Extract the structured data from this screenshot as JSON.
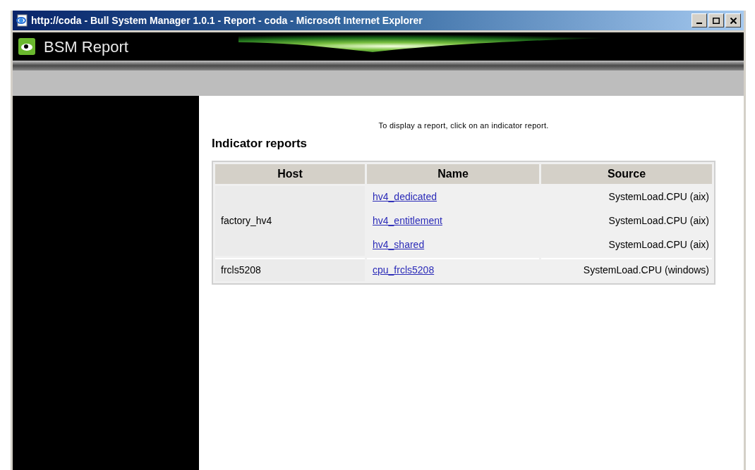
{
  "window": {
    "title": "http://coda - Bull System Manager 1.0.1 - Report - coda - Microsoft Internet Explorer"
  },
  "header": {
    "title": "BSM Report"
  },
  "content": {
    "instruction": "To display a report, click on an indicator report.",
    "heading": "Indicator reports",
    "table": {
      "columns": [
        "Host",
        "Name",
        "Source"
      ],
      "groups": [
        {
          "host": "factory_hv4",
          "reports": [
            {
              "name": "hv4_dedicated",
              "source": "SystemLoad.CPU (aix)"
            },
            {
              "name": "hv4_entitlement",
              "source": "SystemLoad.CPU (aix)"
            },
            {
              "name": "hv4_shared",
              "source": "SystemLoad.CPU (aix)"
            }
          ]
        },
        {
          "host": "frcls5208",
          "reports": [
            {
              "name": "cpu_frcls5208",
              "source": "SystemLoad.CPU (windows)"
            }
          ]
        }
      ]
    }
  }
}
